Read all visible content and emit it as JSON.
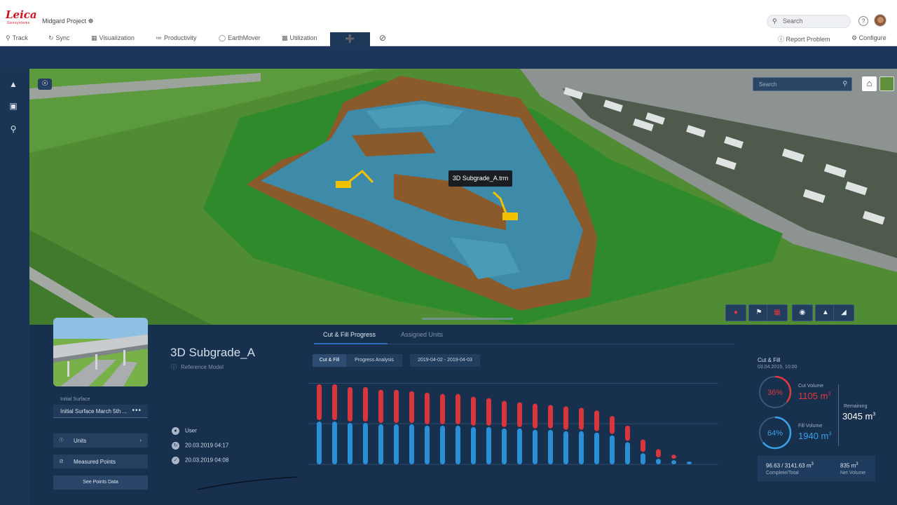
{
  "header": {
    "logo_text": "Leica",
    "logo_sub": "Geosystems",
    "project_name": "Midgard Project ☸",
    "search_placeholder": "Search",
    "help_label": "?"
  },
  "nav": {
    "tabs": [
      {
        "label": "Track",
        "icon": "pin-icon"
      },
      {
        "label": "Sync",
        "icon": "sync-icon"
      },
      {
        "label": "Visualization",
        "icon": "visualization-icon"
      },
      {
        "label": "Productivity",
        "icon": "productivity-icon"
      },
      {
        "label": "EarthMover",
        "icon": "earthmover-icon"
      },
      {
        "label": "Utilization",
        "icon": "utilization-icon"
      }
    ],
    "active_tab_icon": "survey-rod-icon",
    "compass_icon": "compass-icon",
    "report_problem": "Report Problem",
    "configure": "Configure"
  },
  "viewport": {
    "search_placeholder": "Search",
    "model_label": "3D Subgrade_A.trm"
  },
  "model": {
    "title": "3D Subgrade_A",
    "subtitle": "Reference Model",
    "initial_surface_label": "Initial Surface",
    "initial_surface_value": "Initial Surface March 5th ...",
    "units_label": "Units",
    "measured_points_label": "Measured Points",
    "see_points_label": "See Points Data",
    "user_label": "User",
    "date_1": "20.03.2019 04:17",
    "date_2": "20.03.2019 04:08"
  },
  "chart_panel": {
    "tab_active": "Cut & Fill Progress",
    "tab_other": "Assigned Units",
    "seg_cut_fill": "Cut & Fill",
    "seg_progress": "Progress Analysis",
    "date_range": "2019-04-02 - 2019-04-03"
  },
  "chart_data": {
    "type": "bar",
    "stacked": true,
    "series": [
      {
        "name": "Cut",
        "color": "#d8353d",
        "values": [
          26,
          26,
          25,
          25,
          24,
          24,
          23,
          23,
          22,
          22,
          21,
          20,
          19,
          18,
          18,
          17,
          17,
          16,
          15,
          13,
          11,
          9,
          6,
          3,
          0
        ]
      },
      {
        "name": "Fill",
        "color": "#2b8fd6",
        "values": [
          31,
          31,
          30,
          30,
          29,
          29,
          29,
          28,
          28,
          28,
          27,
          27,
          26,
          26,
          25,
          25,
          24,
          24,
          23,
          21,
          16,
          8,
          4,
          3,
          2
        ]
      }
    ],
    "ylim": [
      0,
      60
    ],
    "grid": true
  },
  "summary": {
    "title": "Cut & Fill",
    "date": "03.04.2019, 10:00",
    "cut_percent": "36%",
    "cut_fraction": 0.36,
    "cut_label": "Cut Volume",
    "cut_value": "1105 m",
    "fill_percent": "64%",
    "fill_fraction": 0.64,
    "fill_label": "Fill Volume",
    "fill_value": "1940 m",
    "remaining_label": "Remaining",
    "remaining_value": "3045 m",
    "complete_total": "96.63 / 3141.63 m",
    "complete_label": "Complete/Total",
    "net_value": "835 m",
    "net_label": "Net Volume",
    "unit_exp": "3",
    "colors": {
      "cut": "#e0383d",
      "fill": "#3aa0e8"
    }
  }
}
